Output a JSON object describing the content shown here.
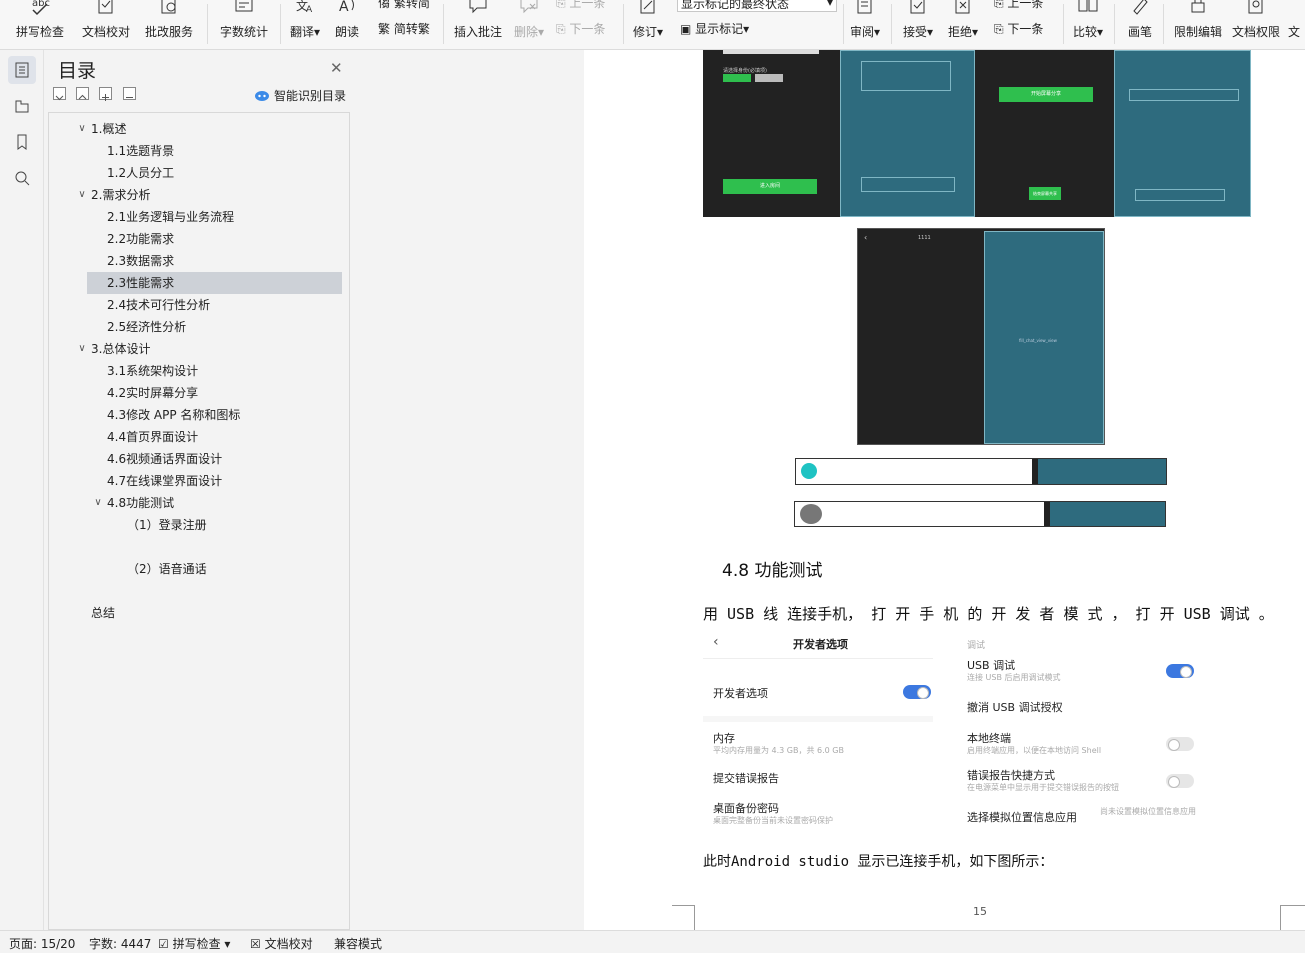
{
  "ribbon": {
    "spell_check": "拼写检查",
    "doc_proof": "文档校对",
    "batch_service": "批改服务",
    "word_count": "字数统计",
    "translate": "翻译",
    "read_aloud": "朗读",
    "trad_to_simp": "繁转简",
    "simp_to_trad": "简转繁",
    "insert_comment": "插入批注",
    "delete": "删除",
    "prev": "上一条",
    "next": "下一条",
    "revise": "修订",
    "markup_state": "显示标记的最终状态",
    "show_markup": "显示标记",
    "review": "审阅",
    "accept": "接受",
    "reject": "拒绝",
    "prev2": "上一条",
    "next2": "下一条",
    "compare": "比较",
    "pen": "画笔",
    "restrict_edit": "限制编辑",
    "doc_permission": "文档权限",
    "more": "文"
  },
  "toc": {
    "title": "目录",
    "smart": "智能识别目录",
    "items": [
      {
        "label": "1.概述",
        "level": 1,
        "expanded": true
      },
      {
        "label": "1.1选题背景",
        "level": 2
      },
      {
        "label": "1.2人员分工",
        "level": 2
      },
      {
        "label": "2.需求分析",
        "level": 1,
        "expanded": true
      },
      {
        "label": "2.1业务逻辑与业务流程",
        "level": 2
      },
      {
        "label": "2.2功能需求",
        "level": 2
      },
      {
        "label": "2.3数据需求",
        "level": 2
      },
      {
        "label": "2.3性能需求",
        "level": 2,
        "selected": true
      },
      {
        "label": "2.4技术可行性分析",
        "level": 2
      },
      {
        "label": "2.5经济性分析",
        "level": 2
      },
      {
        "label": "3.总体设计",
        "level": 1,
        "expanded": true
      },
      {
        "label": "3.1系统架构设计",
        "level": 2
      },
      {
        "label": "4.2实时屏幕分享",
        "level": 2
      },
      {
        "label": "4.3修改 APP 名称和图标",
        "level": 2
      },
      {
        "label": "4.4首页界面设计",
        "level": 2
      },
      {
        "label": "4.6视频通话界面设计",
        "level": 2
      },
      {
        "label": "4.7在线课堂界面设计",
        "level": 2
      },
      {
        "label": "4.8功能测试",
        "level": 2,
        "expanded": true
      },
      {
        "label": "（1）登录注册",
        "level": 3
      },
      {
        "label": "（2）语音通话",
        "level": 3
      },
      {
        "label": "总结",
        "level": 1
      }
    ]
  },
  "doc": {
    "heading": "4.8 功能测试",
    "para1": "用 USB 线 连接手机， 打 开 手 机 的 开 发 者 模 式 ， 打 开 USB 调试 。",
    "para2": "此时Android studio 显示已连接手机，如下图所示：",
    "page_number": "15",
    "phone_left": {
      "header": "开发者选项",
      "dev_opt": "开发者选项",
      "memory": "内存",
      "memory_sub": "平均内存用量为 4.3 GB，共 6.0 GB",
      "bug_report": "提交错误报告",
      "backup_pwd": "桌面备份密码",
      "backup_sub": "桌面完整备份当前未设置密码保护"
    },
    "phone_right": {
      "section": "调试",
      "usb_debug": "USB 调试",
      "usb_debug_sub": "连接 USB 后启用调试模式",
      "revoke": "撤消 USB 调试授权",
      "terminal": "本地终端",
      "terminal_sub": "启用终端应用，以便在本地访问 Shell",
      "bug_shortcut": "错误报告快捷方式",
      "bug_shortcut_sub": "在电源菜单中显示用于提交错误报告的按钮",
      "mock_loc": "选择模拟位置信息应用",
      "mock_loc_val": "尚未设置模拟位置信息应用"
    },
    "mock1": {
      "label1": "请选择身份(必填项)",
      "btn_join": "进入房间",
      "btn_start": "开始屏幕分享",
      "btn_end": "结束屏幕共享",
      "screen_id": "1111",
      "tiny": "fill_chat_view_view"
    }
  },
  "status": {
    "page": "页面: 15/20",
    "words": "字数: 4447",
    "spell": "拼写检查",
    "proof": "文档校对",
    "compat": "兼容模式"
  },
  "colors": {
    "accent_green": "#2fbf4e",
    "teal": "#2e6b7e",
    "toggle_blue": "#3c78e0"
  }
}
